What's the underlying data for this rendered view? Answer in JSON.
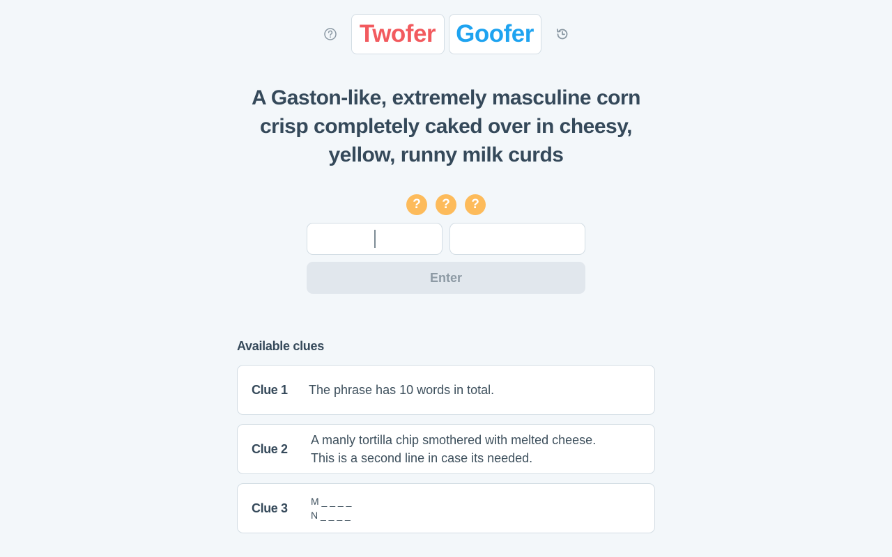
{
  "header": {
    "help_icon": "question-circle-icon",
    "logo_left": "Twofer",
    "logo_right": "Goofer",
    "history_icon": "history-icon",
    "colors": {
      "left": "#f25a5e",
      "right": "#1ea3f0"
    }
  },
  "prompt": {
    "text": "A Gaston-like, extremely masculine corn crisp completely caked over in cheesy, yellow, runny milk curds"
  },
  "hints": [
    {
      "label": "?",
      "color": "#fdbb5b"
    },
    {
      "label": "?",
      "color": "#fdbb5b"
    },
    {
      "label": "?",
      "color": "#fdbb5b"
    }
  ],
  "inputs": {
    "word1": {
      "value": "",
      "placeholder": ""
    },
    "word2": {
      "value": "",
      "placeholder": ""
    }
  },
  "enter_button": {
    "label": "Enter",
    "disabled": true
  },
  "clues": {
    "title": "Available clues",
    "items": [
      {
        "label": "Clue 1",
        "text": "The phrase has 10 words in total."
      },
      {
        "label": "Clue 2",
        "lines": [
          "A manly tortilla chip smothered with melted cheese.",
          "This is a second line in case its needed."
        ]
      },
      {
        "label": "Clue 3",
        "lines": [
          "M _ _ _ _",
          "N _ _ _ _"
        ]
      }
    ]
  }
}
